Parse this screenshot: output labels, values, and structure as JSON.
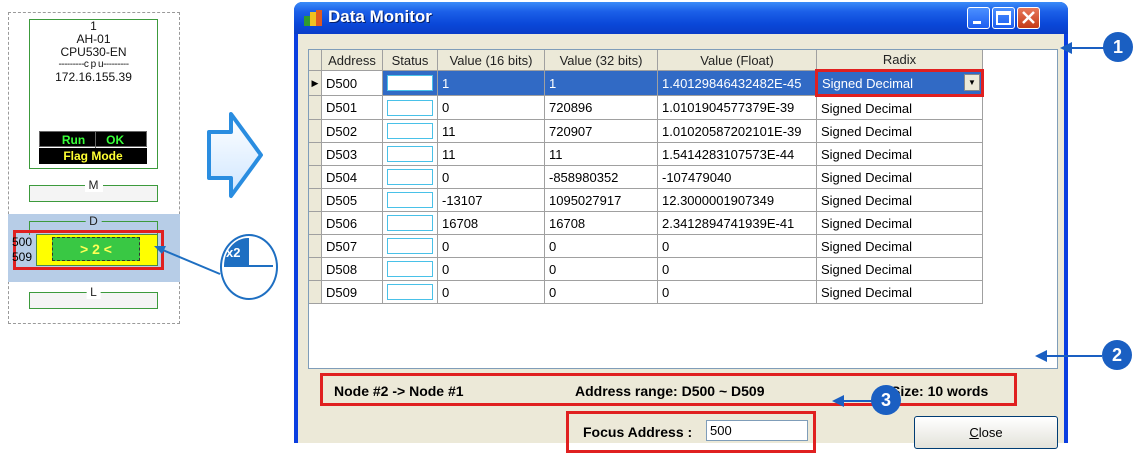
{
  "node": {
    "number": "1",
    "model": "AH-01",
    "cpu_model": "CPU530-EN",
    "cpu_separator": "---------c p u---------",
    "ip": "172.16.155.39",
    "status_run": "Run",
    "status_ok": "OK",
    "status_flag": "Flag Mode",
    "device_m": "M",
    "device_d": "D",
    "device_l": "L",
    "d_start": "500",
    "d_end": "509",
    "d_node_label": "> 2 <"
  },
  "mouse": {
    "click_count": "x2"
  },
  "window": {
    "title": "Data Monitor",
    "columns": [
      "Address",
      "Status",
      "Value (16 bits)",
      "Value (32 bits)",
      "Value (Float)",
      "Radix"
    ],
    "rows": [
      {
        "address": "D500",
        "v16": "1",
        "v32": "1",
        "vfloat": "1.40129846432482E-45",
        "radix": "Signed Decimal"
      },
      {
        "address": "D501",
        "v16": "0",
        "v32": "720896",
        "vfloat": "1.0101904577379E-39",
        "radix": "Signed Decimal"
      },
      {
        "address": "D502",
        "v16": "11",
        "v32": "720907",
        "vfloat": "1.01020587202101E-39",
        "radix": "Signed Decimal"
      },
      {
        "address": "D503",
        "v16": "11",
        "v32": "11",
        "vfloat": "1.5414283107573E-44",
        "radix": "Signed Decimal"
      },
      {
        "address": "D504",
        "v16": "0",
        "v32": "-858980352",
        "vfloat": "-107479040",
        "radix": "Signed Decimal"
      },
      {
        "address": "D505",
        "v16": "-13107",
        "v32": "1095027917",
        "vfloat": "12.3000001907349",
        "radix": "Signed Decimal"
      },
      {
        "address": "D506",
        "v16": "16708",
        "v32": "16708",
        "vfloat": "2.3412894741939E-41",
        "radix": "Signed Decimal"
      },
      {
        "address": "D507",
        "v16": "0",
        "v32": "0",
        "vfloat": "0",
        "radix": "Signed Decimal"
      },
      {
        "address": "D508",
        "v16": "0",
        "v32": "0",
        "vfloat": "0",
        "radix": "Signed Decimal"
      },
      {
        "address": "D509",
        "v16": "0",
        "v32": "0",
        "vfloat": "0",
        "radix": "Signed Decimal"
      }
    ],
    "selected_radix": "Signed Decimal",
    "info_nodes": "Node #2 -> Node #1",
    "info_range": "Address range: D500 ~ D509",
    "info_size": "Size: 10 words",
    "focus_label": "Focus Address :",
    "focus_value": "500",
    "close_label": "Close",
    "close_hotkey": "C",
    "close_rest": "lose"
  },
  "callouts": [
    "1",
    "2",
    "3"
  ],
  "colors": {
    "highlight_red": "#e02020",
    "callout_blue": "#1a5fc2",
    "selection": "#316ac5"
  }
}
